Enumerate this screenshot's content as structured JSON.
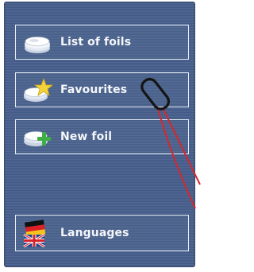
{
  "menu": {
    "items": [
      {
        "id": "list_of_foils",
        "label": "List of foils",
        "icon": "foil-stack-icon"
      },
      {
        "id": "favourites",
        "label": "Favourites",
        "icon": "foil-star-icon"
      },
      {
        "id": "new_foil",
        "label": "New foil",
        "icon": "foil-plus-icon"
      }
    ],
    "languages": {
      "label": "Languages",
      "icon": "flags-icon"
    }
  },
  "colors": {
    "screen_bg": "#465f8c",
    "button_border": "#e9eef7",
    "text": "#f4f6fa",
    "star": "#f3d23a",
    "plus": "#3fae44",
    "stylus_cable": "#d7262e"
  }
}
